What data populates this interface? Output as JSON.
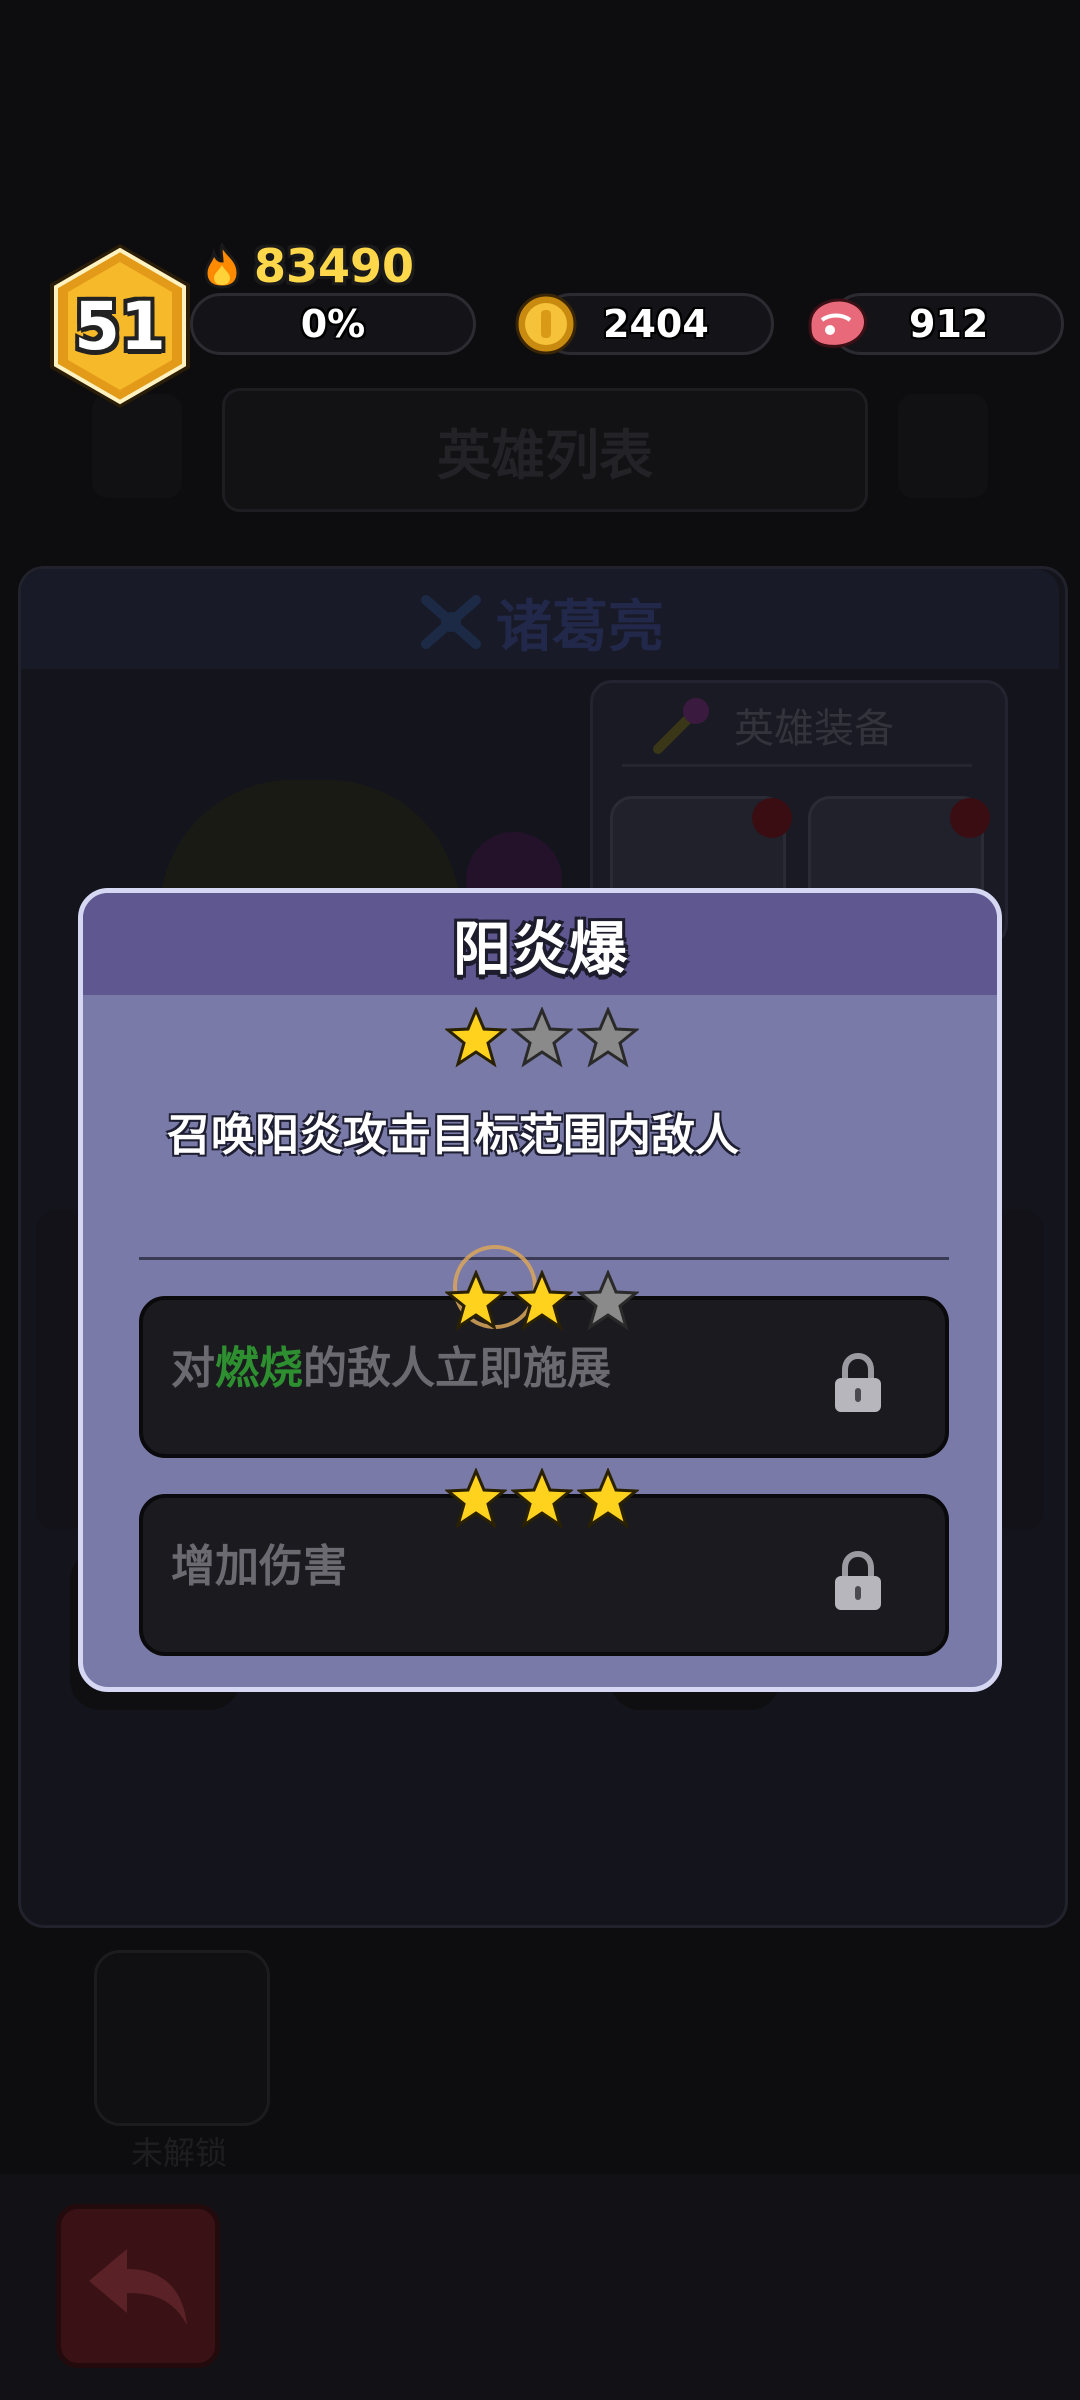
{
  "hud": {
    "level": "51",
    "power": "83490",
    "xp_percent_label": "0%",
    "gold": "2404",
    "meat": "912"
  },
  "background": {
    "screen_title": "英雄列表",
    "hero_name": "诸葛亮",
    "equipment_title": "英雄装备",
    "locked_label": "未解锁"
  },
  "skill_modal": {
    "title": "阳炎爆",
    "stars_filled": 1,
    "stars_total": 3,
    "description": "召唤阳炎攻击目标范围内敌人",
    "upgrades": [
      {
        "stars_required": 2,
        "text_before": "对",
        "text_highlight": "燃烧",
        "text_after": "的敌人立即施展",
        "locked": true
      },
      {
        "stars_required": 3,
        "text_before": "增加伤害",
        "text_highlight": "",
        "text_after": "",
        "locked": true
      }
    ]
  },
  "colors": {
    "modal_body": "#7a7aa8",
    "modal_header": "#5f578f",
    "power_text": "#ffd74a",
    "highlight_green": "#2d8f2f",
    "star_gold": "#ffd21e",
    "star_grey": "#8a8a8a"
  },
  "icons": {
    "power": "flame-icon",
    "gold": "coin-icon",
    "meat": "meat-icon",
    "lock": "lock-icon",
    "back": "back-arrow-icon"
  }
}
